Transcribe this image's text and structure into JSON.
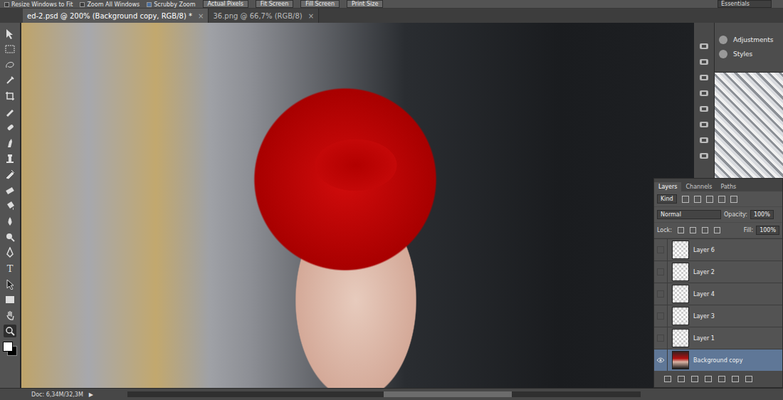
{
  "options_bar": {
    "checkboxes": [
      {
        "label": "Resize Windows to Fit",
        "checked": false
      },
      {
        "label": "Zoom All Windows",
        "checked": false
      },
      {
        "label": "Scrubby Zoom",
        "checked": true
      }
    ],
    "buttons": [
      "Actual Pixels",
      "Fit Screen",
      "Fill Screen",
      "Print Size"
    ],
    "workspace": "Essentials"
  },
  "tabs": [
    {
      "label": "ed-2.psd @ 200% (Background copy, RGB/8) *",
      "close": "×",
      "selected": true
    },
    {
      "label": "36.png @ 66,7% (RGB/8)",
      "close": "×",
      "selected": false
    }
  ],
  "toolbar": {
    "type_tool": "T"
  },
  "dock": {
    "panels": [
      "Adjustments",
      "Styles"
    ]
  },
  "layers_panel": {
    "tabs": [
      {
        "label": "Layers",
        "selected": true
      },
      {
        "label": "Channels",
        "selected": false
      },
      {
        "label": "Paths",
        "selected": false
      }
    ],
    "filter": "Kind",
    "blend_mode": "Normal",
    "opacity_label": "Opacity:",
    "opacity": "100%",
    "lock_label": "Lock:",
    "fill_label": "Fill:",
    "fill": "100%",
    "layers": [
      {
        "name": "Layer 6",
        "visible": false,
        "selected": false
      },
      {
        "name": "Layer 2",
        "visible": false,
        "selected": false
      },
      {
        "name": "Layer 4",
        "visible": false,
        "selected": false
      },
      {
        "name": "Layer 3",
        "visible": false,
        "selected": false
      },
      {
        "name": "Layer 1",
        "visible": false,
        "selected": false
      },
      {
        "name": "Background copy",
        "visible": true,
        "selected": true
      }
    ]
  },
  "status_bar": {
    "doc": "Doc: 6,34M/32,3M",
    "arrow": "▶"
  }
}
